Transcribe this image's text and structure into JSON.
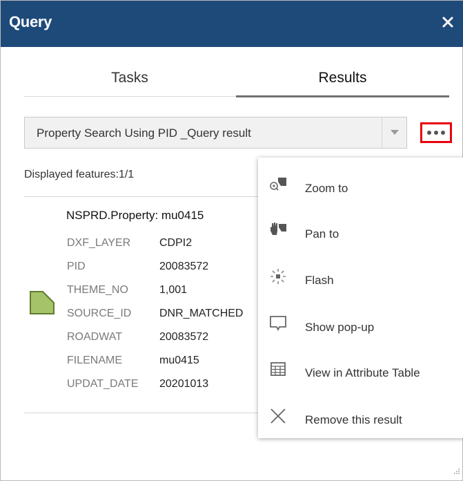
{
  "window": {
    "title": "Query",
    "close_icon": "close-icon"
  },
  "tabs": [
    {
      "label": "Tasks",
      "active": false
    },
    {
      "label": "Results",
      "active": true
    }
  ],
  "result_select": {
    "value": "Property Search Using PID _Query result",
    "arrow_icon": "chevron-down-icon"
  },
  "more_button": {
    "icon": "more-options-icon",
    "highlight_color": "#e8000b"
  },
  "displayed_features": "Displayed features:1/1",
  "feature": {
    "title": "NSPRD.Property: mu0415",
    "icon": "polygon-feature-icon",
    "attributes": [
      {
        "key": "DXF_LAYER",
        "value": "CDPI2"
      },
      {
        "key": "PID",
        "value": "20083572"
      },
      {
        "key": "THEME_NO",
        "value": "1,001"
      },
      {
        "key": "SOURCE_ID",
        "value": "DNR_MATCHED"
      },
      {
        "key": "ROADWAT",
        "value": "20083572"
      },
      {
        "key": "FILENAME",
        "value": "mu0415"
      },
      {
        "key": "UPDAT_DATE",
        "value": "20201013"
      }
    ]
  },
  "menu": {
    "items": [
      {
        "label": "Zoom to",
        "icon": "zoom-to-icon"
      },
      {
        "label": "Pan to",
        "icon": "pan-to-icon"
      },
      {
        "label": "Flash",
        "icon": "flash-icon"
      },
      {
        "label": "Show pop-up",
        "icon": "popup-icon"
      },
      {
        "label": "View in Attribute Table",
        "icon": "table-icon"
      },
      {
        "label": "Remove this result",
        "icon": "remove-icon"
      }
    ]
  },
  "colors": {
    "header": "#1e4a7a",
    "feature_fill": "#a5c46a",
    "feature_stroke": "#5f7a2e"
  }
}
